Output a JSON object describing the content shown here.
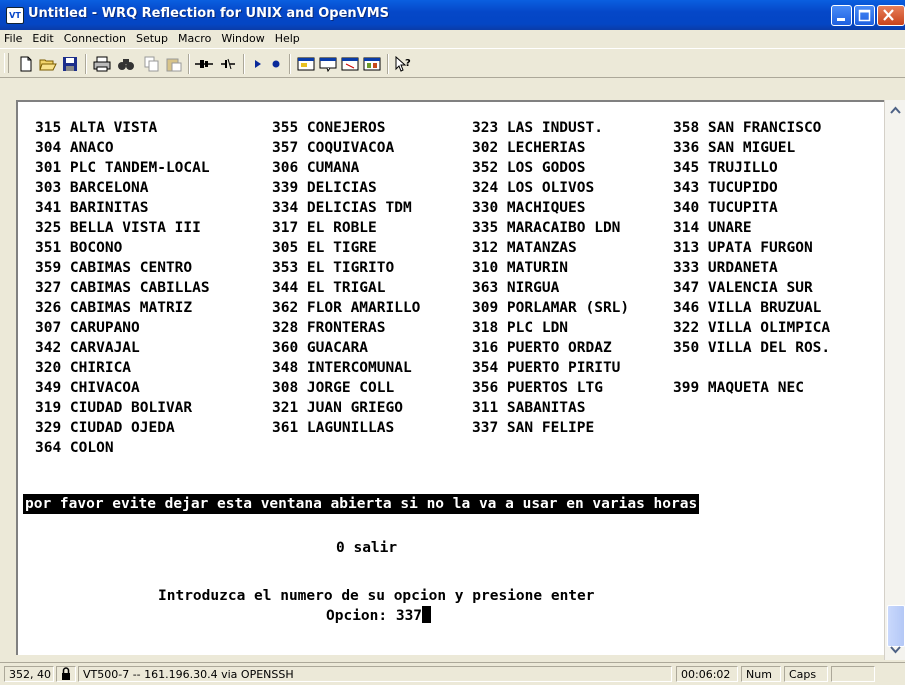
{
  "window": {
    "title": "Untitled - WRQ Reflection for UNIX and OpenVMS",
    "icon_label": "VT"
  },
  "menu": [
    "File",
    "Edit",
    "Connection",
    "Setup",
    "Macro",
    "Window",
    "Help"
  ],
  "toolbar": {
    "icons": [
      "new-icon",
      "open-icon",
      "save-icon",
      "print-icon",
      "find-icon",
      "copy-icon",
      "paste-icon",
      "connect-icon",
      "disconnect-icon",
      "play-macro-icon",
      "record-macro-icon",
      "setup-icon-1",
      "setup-icon-2",
      "setup-icon-3",
      "setup-icon-4",
      "help-pointer-icon"
    ]
  },
  "terminal": {
    "columns": [
      [
        "315 ALTA VISTA",
        "304 ANACO",
        "301 PLC TANDEM-LOCAL",
        "303 BARCELONA",
        "341 BARINITAS",
        "325 BELLA VISTA III",
        "351 BOCONO",
        "359 CABIMAS CENTRO",
        "327 CABIMAS CABILLAS",
        "326 CABIMAS MATRIZ",
        "307 CARUPANO",
        "342 CARVAJAL",
        "320 CHIRICA",
        "349 CHIVACOA",
        "319 CIUDAD BOLIVAR",
        "329 CIUDAD OJEDA",
        "364 COLON"
      ],
      [
        "355 CONEJEROS",
        "357 COQUIVACOA",
        "306 CUMANA",
        "339 DELICIAS",
        "334 DELICIAS TDM",
        "317 EL ROBLE",
        "305 EL TIGRE",
        "353 EL TIGRITO",
        "344 EL TRIGAL",
        "362 FLOR AMARILLO",
        "328 FRONTERAS",
        "360 GUACARA",
        "348 INTERCOMUNAL",
        "308 JORGE COLL",
        "321 JUAN GRIEGO",
        "361 LAGUNILLAS",
        ""
      ],
      [
        "323 LAS INDUST.",
        "302 LECHERIAS",
        "352 LOS GODOS",
        "324 LOS OLIVOS",
        "330 MACHIQUES",
        "335 MARACAIBO LDN",
        "312 MATANZAS",
        "310 MATURIN",
        "363 NIRGUA",
        "309 PORLAMAR (SRL)",
        "318 PLC LDN",
        "316 PUERTO ORDAZ",
        "354 PUERTO PIRITU",
        "356 PUERTOS LTG",
        "311 SABANITAS",
        "337 SAN FELIPE",
        ""
      ],
      [
        "358 SAN FRANCISCO",
        "336 SAN MIGUEL",
        "345 TRUJILLO",
        "343 TUCUPIDO",
        "340 TUCUPITA",
        "314 UNARE",
        "313 UPATA FURGON",
        "333 URDANETA",
        "347 VALENCIA SUR",
        "346 VILLA BRUZUAL",
        "322 VILLA OLIMPICA",
        "350 VILLA DEL ROS.",
        "",
        "399 MAQUETA NEC",
        "",
        "",
        ""
      ]
    ],
    "notice": "por favor evite dejar esta ventana abierta si no la va a usar en varias horas",
    "exit_option": "0 salir",
    "prompt": "Introduzca el numero de su opcion y presione enter",
    "option_label": "Opcion: ",
    "option_value": "337"
  },
  "status": {
    "cursor_pos": "352, 40",
    "connection": "VT500-7 -- 161.196.30.4 via OPENSSH",
    "elapsed": "00:06:02",
    "num": "Num",
    "caps": "Caps"
  }
}
